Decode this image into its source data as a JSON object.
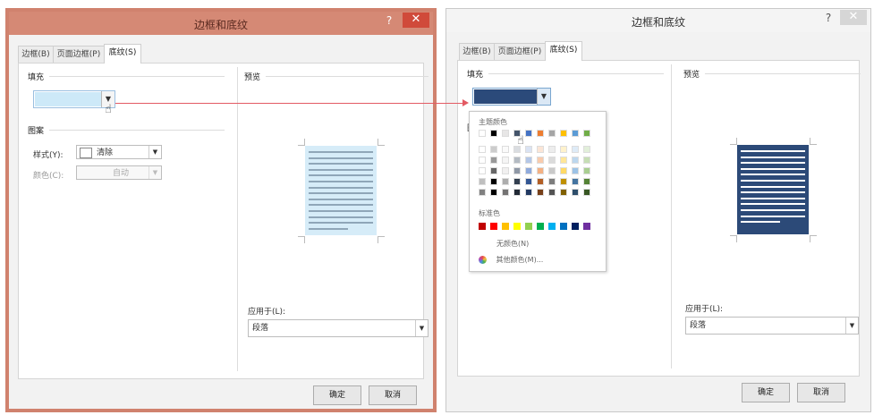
{
  "dialog_left": {
    "title": "边框和底纹",
    "tabs": [
      "边框(B)",
      "页面边框(P)",
      "底纹(S)"
    ],
    "active_tab": 2,
    "fill": {
      "label": "填充",
      "color": "#cde9f8"
    },
    "pattern": {
      "label": "图案",
      "style_label": "样式(Y):",
      "style_value": "清除",
      "color_label": "颜色(C):",
      "color_value": "自动"
    },
    "preview": {
      "label": "预览",
      "fill_color": "#d6ecf8",
      "line_color": "#8fa6b8"
    },
    "apply_to": {
      "label": "应用于(L):",
      "value": "段落"
    },
    "buttons": {
      "ok": "确定",
      "cancel": "取消"
    }
  },
  "dialog_right": {
    "title": "边框和底纹",
    "tabs": [
      "边框(B)",
      "页面边框(P)",
      "底纹(S)"
    ],
    "active_tab": 2,
    "fill": {
      "label": "填充",
      "color": "#2b4a7a"
    },
    "pattern_label": "图",
    "preview": {
      "label": "预览",
      "fill_color": "#2c4a78",
      "line_color": "#ffffff"
    },
    "apply_to": {
      "label": "应用于(L):",
      "value": "段落"
    },
    "buttons": {
      "ok": "确定",
      "cancel": "取消"
    },
    "color_menu": {
      "theme_label": "主题颜色",
      "standard_label": "标准色",
      "no_color": "无颜色(N)",
      "more_colors": "其他颜色(M)...",
      "theme_top": [
        "#ffffff",
        "#000000",
        "#e7e6e6",
        "#44546a",
        "#4472c4",
        "#ed7d31",
        "#a5a5a5",
        "#ffc000",
        "#5b9bd5",
        "#70ad47"
      ],
      "standard": [
        "#c00000",
        "#ff0000",
        "#ffc000",
        "#ffff00",
        "#92d050",
        "#00b050",
        "#00b0f0",
        "#0070c0",
        "#002060",
        "#7030a0"
      ]
    }
  },
  "colors": {
    "accent_line": "#e35a63",
    "left_border": "#d58975"
  }
}
